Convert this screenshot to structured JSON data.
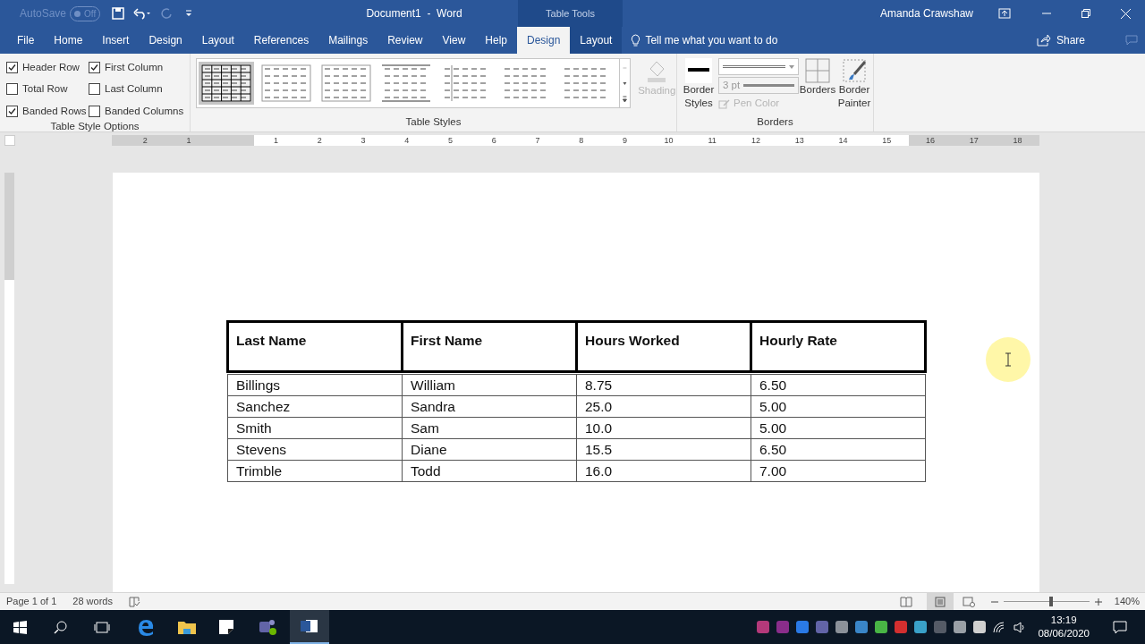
{
  "title_bar": {
    "autosave": {
      "label": "AutoSave",
      "state": "Off"
    },
    "title": "Document1  -  Word",
    "context_label": "Table Tools",
    "user": "Amanda Crawshaw"
  },
  "tabs": [
    {
      "label": "File",
      "selected": false,
      "contextual": false
    },
    {
      "label": "Home",
      "selected": false,
      "contextual": false
    },
    {
      "label": "Insert",
      "selected": false,
      "contextual": false
    },
    {
      "label": "Design",
      "selected": false,
      "contextual": false
    },
    {
      "label": "Layout",
      "selected": false,
      "contextual": false
    },
    {
      "label": "References",
      "selected": false,
      "contextual": false
    },
    {
      "label": "Mailings",
      "selected": false,
      "contextual": false
    },
    {
      "label": "Review",
      "selected": false,
      "contextual": false
    },
    {
      "label": "View",
      "selected": false,
      "contextual": false
    },
    {
      "label": "Help",
      "selected": false,
      "contextual": false
    },
    {
      "label": "Design",
      "selected": true,
      "contextual": true
    },
    {
      "label": "Layout",
      "selected": false,
      "contextual": true
    }
  ],
  "tell_me": "Tell me what you want to do",
  "share": "Share",
  "ribbon": {
    "style_options": {
      "label": "Table Style Options",
      "options": [
        {
          "label": "Header Row",
          "checked": true
        },
        {
          "label": "First Column",
          "checked": true
        },
        {
          "label": "Total Row",
          "checked": false
        },
        {
          "label": "Last Column",
          "checked": false
        },
        {
          "label": "Banded Rows",
          "checked": true
        },
        {
          "label": "Banded Columns",
          "checked": false
        }
      ]
    },
    "table_styles": {
      "label": "Table Styles",
      "styles": [
        {
          "selected": true
        },
        {
          "selected": false
        },
        {
          "selected": false
        },
        {
          "selected": false
        },
        {
          "selected": false
        },
        {
          "selected": false
        },
        {
          "selected": false
        }
      ]
    },
    "shading": {
      "label": "Shading",
      "disabled": true
    },
    "borders": {
      "label": "Borders",
      "border_styles": "Border Styles",
      "pen_weight": "3 pt",
      "pen_color": {
        "label": "Pen Color",
        "disabled": true
      },
      "borders_button": "Borders",
      "border_painter": "Border Painter"
    }
  },
  "ruler": {
    "left_numbers": [
      "2",
      "1"
    ],
    "numbers": [
      "1",
      "2",
      "3",
      "4",
      "5",
      "6",
      "7",
      "8",
      "9",
      "10",
      "11",
      "12",
      "13",
      "14",
      "15",
      "16",
      "17",
      "18"
    ]
  },
  "table": {
    "columns": [
      "Last Name",
      "First Name",
      "Hours Worked",
      "Hourly Rate"
    ],
    "rows": [
      [
        "Billings",
        "William",
        "8.75",
        "6.50"
      ],
      [
        "Sanchez",
        "Sandra",
        "25.0",
        "5.00"
      ],
      [
        "Smith",
        "Sam",
        "10.0",
        "5.00"
      ],
      [
        "Stevens",
        "Diane",
        "15.5",
        "6.50"
      ],
      [
        "Trimble",
        "Todd",
        "16.0",
        "7.00"
      ]
    ]
  },
  "status_bar": {
    "page": "Page 1 of 1",
    "words": "28 words",
    "zoom": "140%",
    "zoom_slider": {
      "level": 0.55
    }
  },
  "taskbar": {
    "time": "13:19",
    "date": "08/06/2020"
  }
}
